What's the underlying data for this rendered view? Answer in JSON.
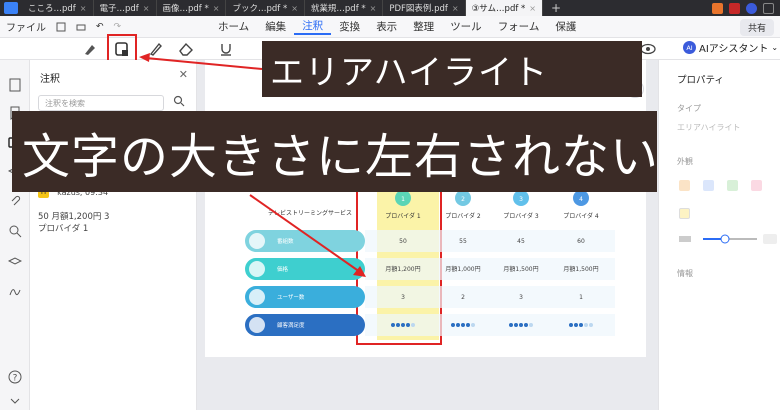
{
  "tabs": [
    {
      "label": "こころ…pdf"
    },
    {
      "label": "電子…pdf"
    },
    {
      "label": "画像…pdf *"
    },
    {
      "label": "ブック…pdf *"
    },
    {
      "label": "就業規…pdf *"
    },
    {
      "label": "PDF図表例.pdf"
    },
    {
      "label": "③サム…pdf *",
      "active": true
    }
  ],
  "menu": {
    "file": "ファイル",
    "items": [
      "ホーム",
      "編集",
      "注釈",
      "変換",
      "表示",
      "整理",
      "ツール",
      "フォーム",
      "保護"
    ],
    "active": "注釈",
    "share": "共有"
  },
  "toolbar": {
    "ai_label": "AIアシスタント",
    "ai_badge": "AI"
  },
  "comments_panel": {
    "title": "注釈",
    "search_placeholder": "注釈を検索",
    "comment": {
      "badge": "H",
      "author_time": "kazus,  09:34",
      "line1": "50 月額1,200円 3",
      "line2": "プロバイダ 1"
    }
  },
  "properties_panel": {
    "title": "プロパティ",
    "type_label": "タイプ",
    "type_value": "エリアハイライト",
    "appearance_label": "外観",
    "info_label": "情報"
  },
  "overlays": {
    "callout_small": "エリアハイライト",
    "callout_big": "文字の大きさに左右されない"
  },
  "accent_color": "#2b6cf5",
  "highlight_box_color": "#e02424",
  "chart_data": {
    "type": "table",
    "title": "テレビストリーミングサービス",
    "columns": [
      "プロバイダ 1",
      "プロバイダ 2",
      "プロバイダ 3",
      "プロバイダ 4"
    ],
    "column_numbers": [
      "1",
      "2",
      "3",
      "4"
    ],
    "rows": [
      {
        "label": "番組数",
        "values": [
          "50",
          "55",
          "45",
          "60"
        ]
      },
      {
        "label": "価格",
        "values": [
          "月額1,200円",
          "月額1,000円",
          "月額1,500円",
          "月額1,500円"
        ]
      },
      {
        "label": "ユーザー数",
        "values": [
          "3",
          "2",
          "3",
          "1"
        ]
      },
      {
        "label": "顧客満足度",
        "values": [
          4,
          4,
          4,
          3
        ],
        "max": 5
      }
    ],
    "highlighted_column": "プロバイダ 1"
  }
}
